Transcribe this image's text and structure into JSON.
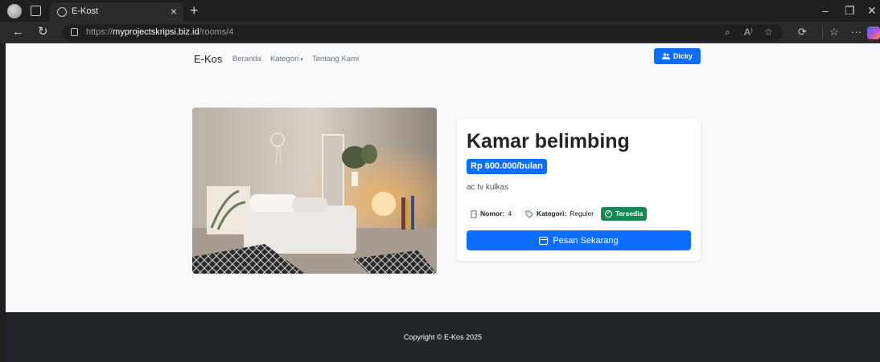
{
  "browser": {
    "tab_title": "E-Kost",
    "tab_close": "×",
    "new_tab": "+",
    "window_controls": {
      "minimize": "–",
      "restore": "❐",
      "close": "✕"
    },
    "nav": {
      "back": "←",
      "refresh": "↻"
    },
    "url": {
      "scheme": "https://",
      "host": "myprojectskripsi.biz.id",
      "path": "/rooms/4"
    },
    "url_actions": {
      "zoom": "⌕",
      "read_aloud": "A⁾",
      "favorite": "☆"
    },
    "toolbar": {
      "extensions": "⟳",
      "favorites": "☆",
      "more": "···"
    }
  },
  "navbar": {
    "brand": "E-Kos",
    "links": [
      "Beranda",
      "Kategori",
      "Tentang Kami"
    ],
    "dropdown_caret": "▾",
    "user_button": {
      "icon": "users-icon",
      "label": "Dicky"
    }
  },
  "room": {
    "title": "Kamar belimbing",
    "price": "Rp 600.000/bulan",
    "facilities": "ac tv kulkas",
    "number_label": "Nomor:",
    "number_value": "4",
    "category_label": "Kategori:",
    "category_value": "Reguler",
    "status": "Tersedia",
    "book_button": "Pesan Sekarang"
  },
  "footer": {
    "copyright": "Copyright © E-Kos 2025"
  },
  "colors": {
    "primary": "#0d6efd",
    "success": "#198754",
    "dark": "#212529",
    "page_bg": "#f8f9fa"
  }
}
